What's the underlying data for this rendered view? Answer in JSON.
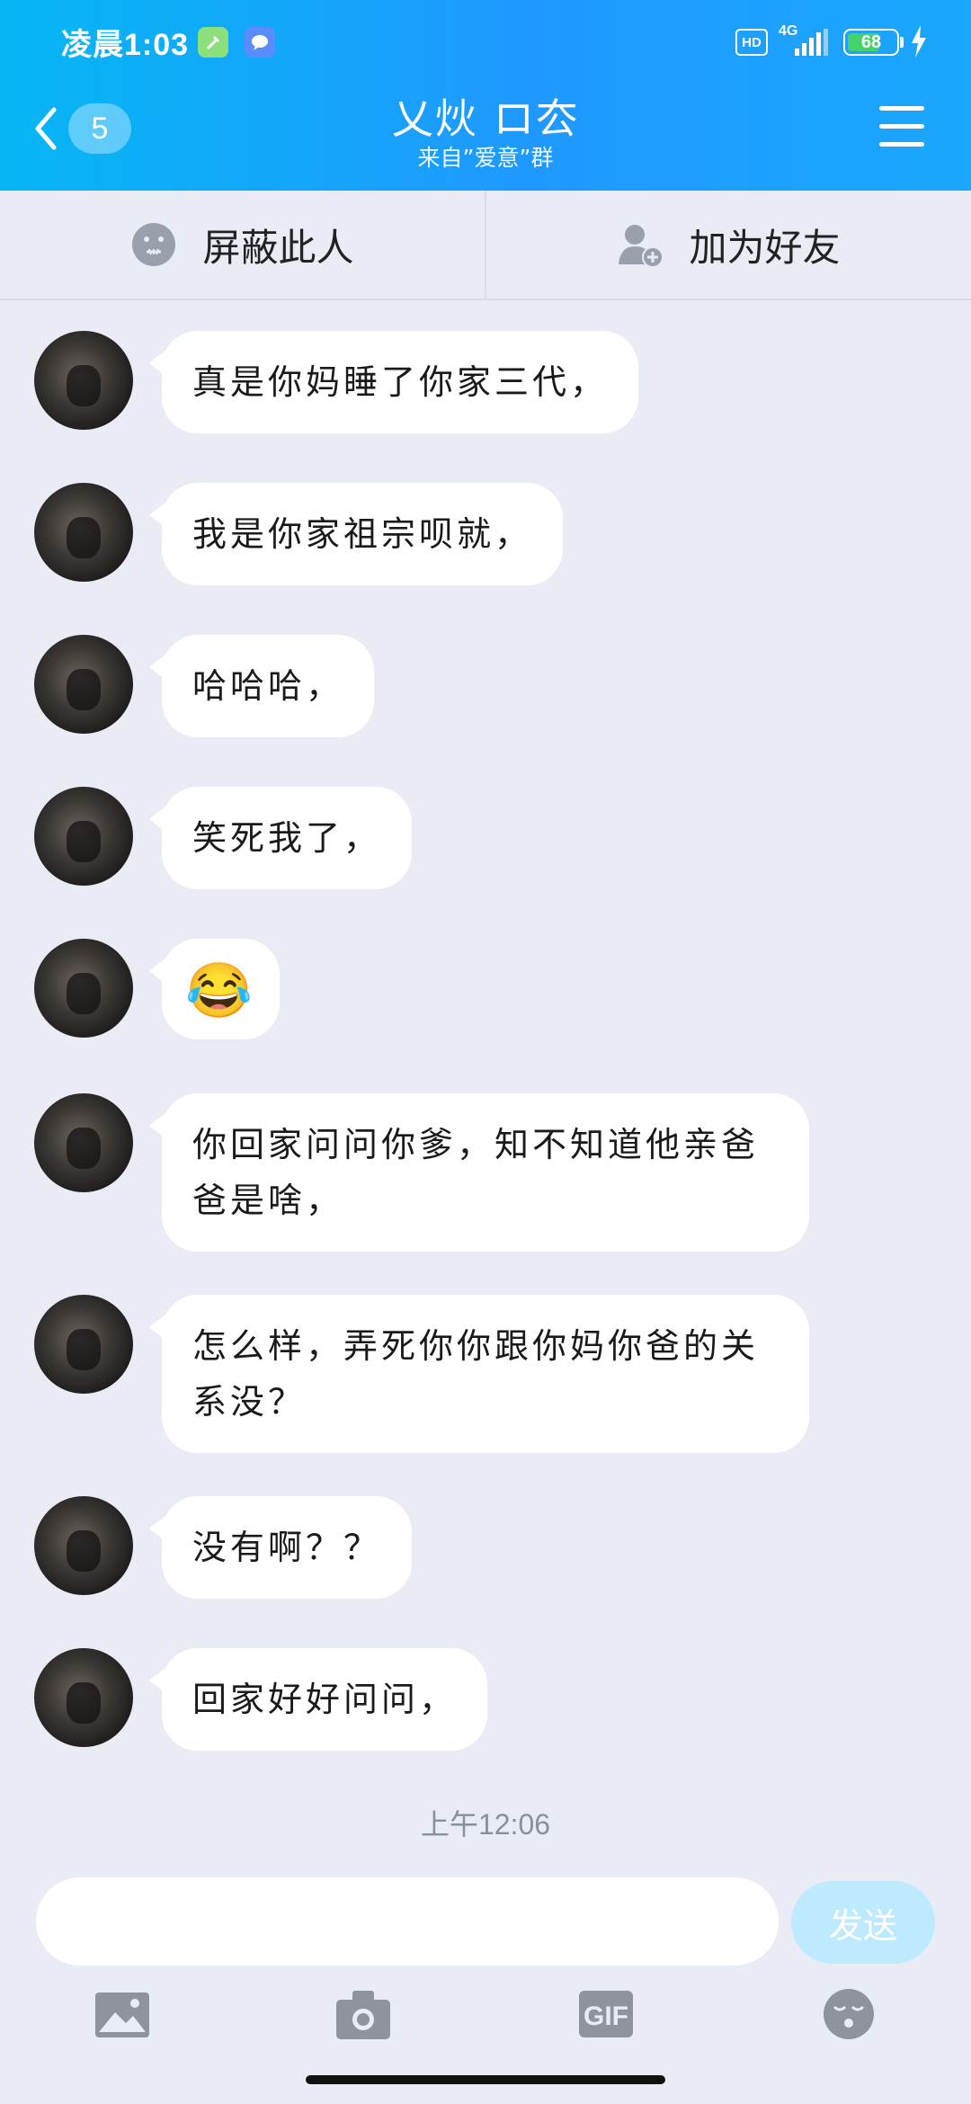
{
  "status_bar": {
    "time": "凌晨1:03",
    "hd": "HD",
    "network": "4G",
    "battery": "68",
    "battery_level": 0.68
  },
  "header": {
    "unread_count": "5",
    "title": "乂炏 ロ厺",
    "subtitle": "来自”爱意”群"
  },
  "actions": {
    "block_label": "屏蔽此人",
    "add_friend_label": "加为好友"
  },
  "messages": [
    {
      "text": "真是你妈睡了你家三代，"
    },
    {
      "text": "我是你家祖宗呗就，"
    },
    {
      "text": "哈哈哈，"
    },
    {
      "text": "笑死我了，"
    },
    {
      "emoji": "😂"
    },
    {
      "text": "你回家问问你爹，知不知道他亲爸爸是啥，"
    },
    {
      "text": "怎么样，弄死你你跟你妈你爸的关系没？"
    },
    {
      "text": "没有啊？？"
    },
    {
      "text": "回家好好问问，"
    }
  ],
  "timestamp": "上午12:06",
  "composer": {
    "input_value": "",
    "send_label": "发送"
  },
  "toolbar": {
    "gif_label": "GIF",
    "icons": [
      "image-icon",
      "camera-icon",
      "gif-icon",
      "sticker-face-icon"
    ]
  },
  "colors": {
    "header_start": "#06b6f4",
    "header_end": "#1aa7ff",
    "background": "#e9ecf5",
    "send_button": "#bdeaff"
  }
}
